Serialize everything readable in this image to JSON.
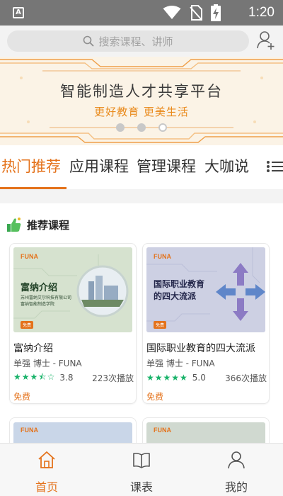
{
  "status_bar": {
    "time": "1:20",
    "app_icon_letter": "A",
    "icons": [
      "wifi-icon",
      "no-sim-icon",
      "battery-charging-icon"
    ]
  },
  "search": {
    "placeholder": "搜索课程、讲师"
  },
  "banner": {
    "title": "智能制造人才共享平台",
    "subtitle": "更好教育 更美生活",
    "slide_count": 3,
    "active_slide": 3
  },
  "tabs": {
    "items": [
      {
        "label": "热门推荐",
        "active": true
      },
      {
        "label": "应用课程",
        "active": false
      },
      {
        "label": "管理课程",
        "active": false
      },
      {
        "label": "大咖说",
        "active": false
      }
    ]
  },
  "section": {
    "title": "推荐课程"
  },
  "courses": [
    {
      "title": "富纳介绍",
      "author": "单强 博士 - FUNA",
      "rating_value": 3.8,
      "rating": "3.8",
      "plays": "223次播放",
      "price": "免费",
      "thumb": {
        "brand": "FUNA",
        "heading": "富纳介绍",
        "lines": [
          "苏州富纳艾尔科技有限公司",
          "富纳智能制造学院"
        ],
        "tag": "免费"
      }
    },
    {
      "title": "国际职业教育的四大流派",
      "author": "单强 博士 - FUNA",
      "rating_value": 5.0,
      "rating": "5.0",
      "plays": "366次播放",
      "price": "免费",
      "thumb": {
        "brand": "FUNA",
        "heading": "国际职业教育的四大流派",
        "tag": "免费"
      }
    }
  ],
  "bottom_nav": [
    {
      "label": "首页",
      "icon": "home-icon",
      "active": true
    },
    {
      "label": "课表",
      "icon": "book-icon",
      "active": false
    },
    {
      "label": "我的",
      "icon": "profile-icon",
      "active": false
    }
  ],
  "colors": {
    "accent": "#e4721b",
    "star": "#19b36a",
    "status_bar": "#767676"
  }
}
